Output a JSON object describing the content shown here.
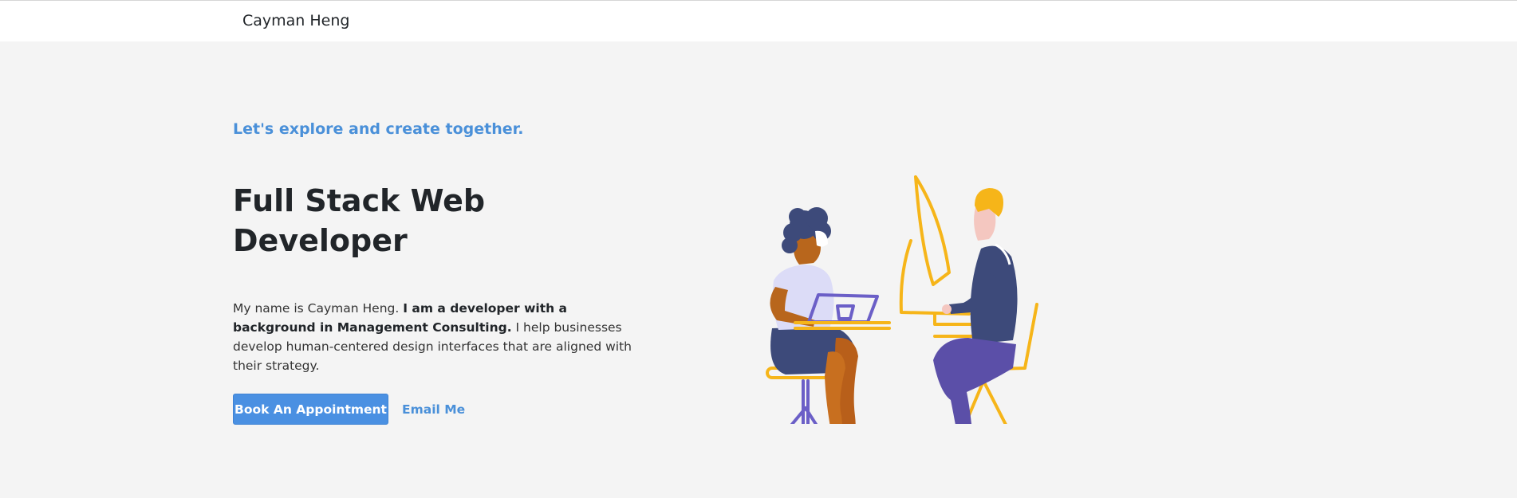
{
  "navbar": {
    "brand": "Cayman Heng"
  },
  "hero": {
    "tagline": "Let's explore and create together.",
    "title_line1": "Full Stack Web",
    "title_line2": "Developer",
    "intro_plain_1": "My name is Cayman Heng. ",
    "intro_bold": "I am a developer with a background in Management Consulting.",
    "intro_plain_2": " I help businesses develop human-centered design interfaces that are aligned with their strategy.",
    "primary_button": "Book An Appointment",
    "secondary_link": "Email Me"
  },
  "colors": {
    "accent": "#4a90e2",
    "hero_background": "#f4f4f4",
    "illustration_yellow": "#f6b519",
    "illustration_purple": "#6b5fc7",
    "illustration_navy": "#3d4a7a"
  }
}
